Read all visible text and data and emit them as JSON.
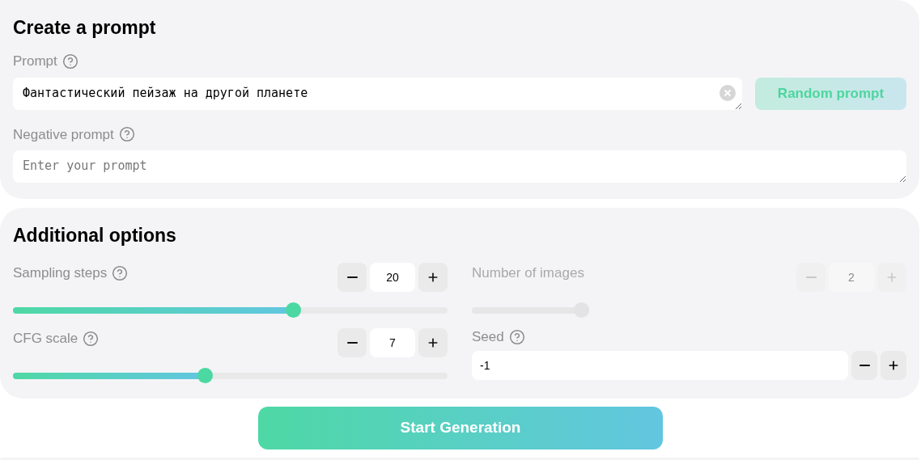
{
  "prompt_section": {
    "title": "Create a prompt",
    "prompt": {
      "label": "Prompt",
      "value": "Фантастический пейзаж на другой планете"
    },
    "random_button": "Random prompt",
    "negative_prompt": {
      "label": "Negative prompt",
      "placeholder": "Enter your prompt"
    }
  },
  "options_section": {
    "title": "Additional options",
    "settings": [
      {
        "kind": "slider",
        "label": "Sampling steps",
        "help": true,
        "value": "20",
        "level": 0.65,
        "disabled": false
      },
      {
        "kind": "slider",
        "label": "Number of images",
        "help": false,
        "value": "2",
        "level": 1,
        "disabled": true
      },
      {
        "kind": "slider",
        "label": "CFG scale",
        "help": true,
        "value": "7",
        "level": 0.44,
        "disabled": false
      },
      {
        "kind": "seed",
        "label": "Seed",
        "help": true,
        "value": "-1",
        "disabled": false
      }
    ]
  },
  "start_button": "Start Generation"
}
